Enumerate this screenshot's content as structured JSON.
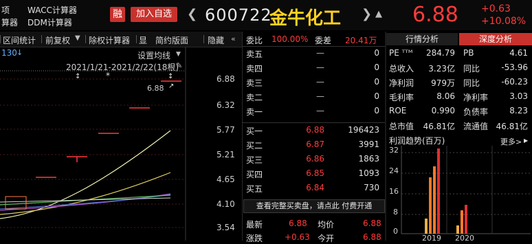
{
  "topbar": {
    "left_top_1": "项",
    "left_top_2": "WACC计算器",
    "left_bot_1": "算器",
    "left_bot_2": "DDM计算器",
    "rong_label": "融",
    "add_label": "加入自选",
    "code": "600722",
    "name": "金牛化工",
    "price": "6.88",
    "change": "+0.63",
    "change_pct": "+10.08%"
  },
  "toolbar": {
    "items": [
      "区间统计",
      "前复权",
      "除权计算器",
      "显",
      "简约版面",
      "隐藏"
    ]
  },
  "chart": {
    "corner_label": "130",
    "setting_label": "设置均线",
    "range_label": "2021/1/21-2021/2/22(18根)",
    "last_price_label": "6.88",
    "y_ticks": [
      "6.88",
      "6.32",
      "5.77",
      "5.21",
      "4.65",
      "4.10",
      "3.54"
    ]
  },
  "orderbook": {
    "weibi_label": "委比",
    "weibi_value": "100.00%",
    "weicha_label": "委差",
    "weicha_value": "20.41万",
    "asks": [
      {
        "label": "卖五",
        "price": "—",
        "vol": "0"
      },
      {
        "label": "卖四",
        "price": "—",
        "vol": "0"
      },
      {
        "label": "卖三",
        "price": "—",
        "vol": "0"
      },
      {
        "label": "卖二",
        "price": "—",
        "vol": "0"
      },
      {
        "label": "卖一",
        "price": "—",
        "vol": "0"
      }
    ],
    "bids": [
      {
        "label": "买一",
        "price": "6.88",
        "vol": "196423"
      },
      {
        "label": "买二",
        "price": "6.87",
        "vol": "3991"
      },
      {
        "label": "买三",
        "price": "6.86",
        "vol": "1863"
      },
      {
        "label": "买四",
        "price": "6.85",
        "vol": "1093"
      },
      {
        "label": "买五",
        "price": "6.84",
        "vol": "730"
      }
    ],
    "notice": "查看完整买卖盘，请点此 付费开通",
    "latest_label": "最新",
    "latest_value": "6.88",
    "avg_label": "均价",
    "avg_value": "6.88",
    "zd_label": "涨跌",
    "zd_value": "+0.63",
    "open_label": "今开",
    "open_value": "6.88"
  },
  "right": {
    "tab_analysis": "行情分析",
    "tab_deep": "深度分析",
    "fundamentals": [
      {
        "l1": "PE ᵀᵀᴹ",
        "v1": "284.79",
        "l2": "PB",
        "v2": "4.61"
      },
      {
        "l1": "总收入",
        "v1": "3.23亿",
        "l2": "同比",
        "v2": "-53.96"
      },
      {
        "l1": "净利润",
        "v1": "979万",
        "l2": "同比",
        "v2": "-60.23"
      },
      {
        "l1": "毛利率",
        "v1": "8.06",
        "l2": "净利率",
        "v2": "3.03"
      },
      {
        "l1": "ROE",
        "v1": "0.990",
        "l2": "负债率",
        "v2": "8.23"
      },
      {
        "l1": "总市值",
        "v1": "46.81亿",
        "l2": "流通值",
        "v2": "46.81亿"
      }
    ],
    "profit_title": "利润趋势(百万)",
    "more_label": "更多>",
    "y_ticks": [
      "32",
      "24",
      "16",
      "8",
      "0"
    ],
    "x_ticks": [
      "2019",
      "2020"
    ]
  },
  "colors": {
    "up": "#ff3b3b",
    "accent": "#c8322d",
    "name": "#ffd21e",
    "bg": "#000000"
  }
}
